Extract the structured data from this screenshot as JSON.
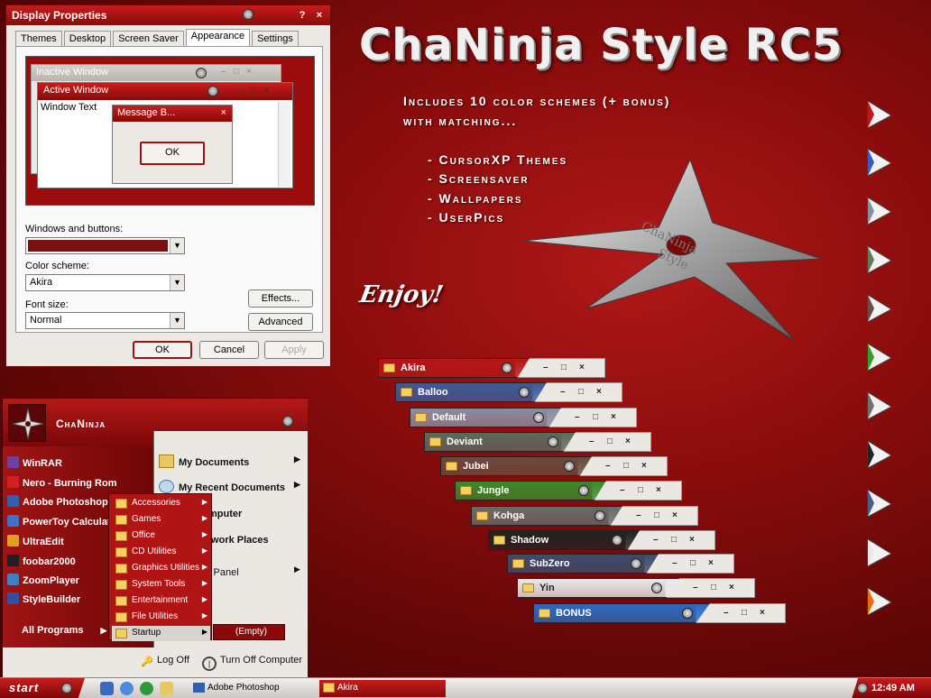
{
  "title": "ChaNinja Style RC5",
  "promo_lines": [
    "Includes 10 color schemes (+ bonus)",
    "with matching..."
  ],
  "features": [
    "- CursorXP Themes",
    "- Screensaver",
    "- Wallpapers",
    "- UserPics"
  ],
  "enjoy": "Enjoy!",
  "shuriken_text": [
    "ChaNinja",
    "Style"
  ],
  "dialog": {
    "title": "Display Properties",
    "help": "?",
    "close": "×",
    "tabs": [
      "Themes",
      "Desktop",
      "Screen Saver",
      "Appearance",
      "Settings"
    ],
    "active_tab": "Appearance",
    "preview": {
      "inactive_title": "Inactive Window",
      "active_title": "Active Window",
      "window_text": "Window Text",
      "message_title": "Message B...",
      "ok": "OK"
    },
    "windows_buttons_label": "Windows and buttons:",
    "color_scheme_label": "Color scheme:",
    "color_scheme_value": "Akira",
    "font_size_label": "Font size:",
    "font_size_value": "Normal",
    "effects": "Effects...",
    "advanced": "Advanced",
    "ok": "OK",
    "cancel": "Cancel",
    "apply": "Apply",
    "accent_color": "#7a1010"
  },
  "schemes": [
    {
      "name": "Akira",
      "color": "#b51616"
    },
    {
      "name": "Balloo",
      "color": "#3a5c9a"
    },
    {
      "name": "Default",
      "color": "#8a8da0"
    },
    {
      "name": "Deviant",
      "color": "#5c6b5c"
    },
    {
      "name": "Jubei",
      "color": "#6a4a3c"
    },
    {
      "name": "Jungle",
      "color": "#3a8a2a"
    },
    {
      "name": "Kohga",
      "color": "#6a6a6a"
    },
    {
      "name": "Shadow",
      "color": "#222222"
    },
    {
      "name": "SubZero",
      "color": "#3c4c6c"
    },
    {
      "name": "Yin",
      "color": "#e8e8e8"
    },
    {
      "name": "BONUS",
      "color": "#2a6ac0"
    }
  ],
  "cursor_colors": [
    "#c01818",
    "#3a5cba",
    "#8a8da0",
    "#5c7c5c",
    "#6a5040",
    "#2ea02a",
    "#707070",
    "#222222",
    "#4a5c8c",
    "#e8e8e8",
    "#e07010"
  ],
  "start_menu": {
    "user": "ChaNinja",
    "left_items": [
      {
        "label": "WinRAR",
        "color": "#7040a0"
      },
      {
        "label": "Nero - Burning Rom",
        "color": "#d02020"
      },
      {
        "label": "Adobe Photoshop 7.0",
        "color": "#3060b0"
      },
      {
        "label": "PowerToy Calculator",
        "color": "#4070c0"
      },
      {
        "label": "UltraEdit",
        "color": "#e0a020"
      },
      {
        "label": "foobar2000",
        "color": "#202020"
      },
      {
        "label": "ZoomPlayer",
        "color": "#4080c0"
      },
      {
        "label": "StyleBuilder",
        "color": "#3050a0"
      }
    ],
    "all_programs": "All Programs",
    "right_items": [
      "My Documents",
      "My Recent Documents",
      "My Computer",
      "My Network Places",
      "Control Panel"
    ],
    "log_off": "Log Off",
    "turn_off": "Turn Off Computer"
  },
  "programs_submenu": [
    "Accessories",
    "Games",
    "Office",
    "CD Utilities",
    "Graphics Utilities",
    "System Tools",
    "Entertainment",
    "File Utilities",
    "Startup"
  ],
  "startup_empty": "(Empty)",
  "taskbar": {
    "start": "start",
    "buttons": [
      "Adobe Photoshop",
      "Akira"
    ],
    "clock": "12:49 AM"
  }
}
